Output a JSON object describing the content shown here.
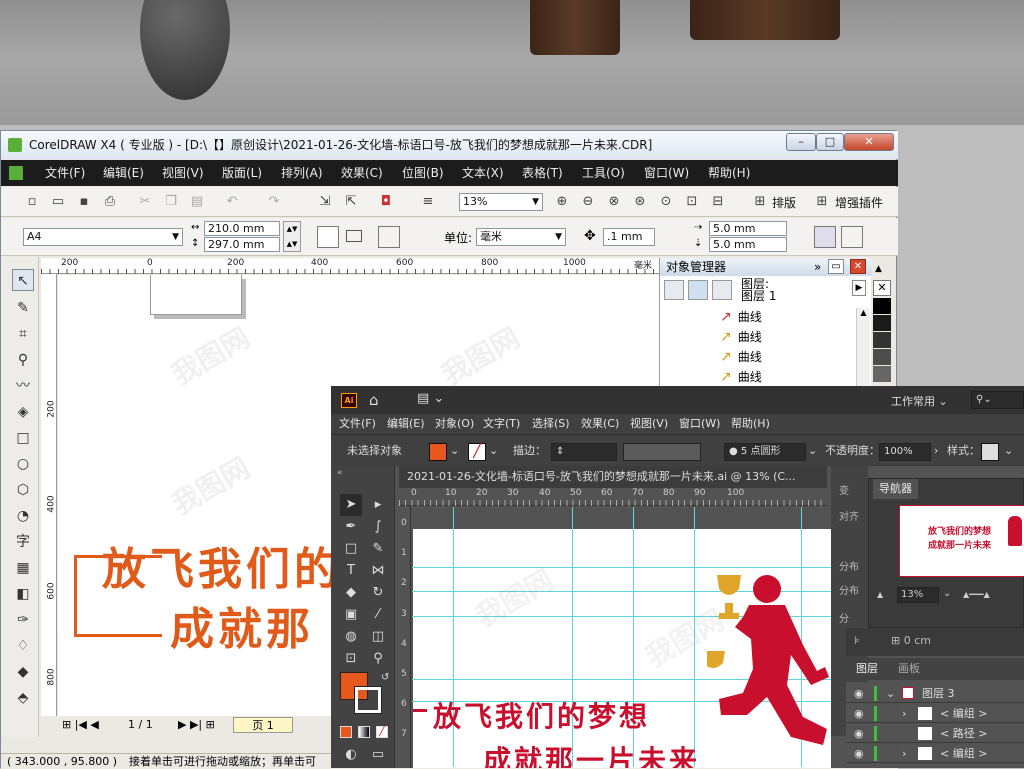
{
  "corel": {
    "title": "CorelDRAW X4 ( 专业版 ) - [D:\\【】原创设计\\2021-01-26-文化墙-标语口号-放飞我们的梦想成就那一片未来.CDR]",
    "menu": [
      "文件(F)",
      "编辑(E)",
      "视图(V)",
      "版面(L)",
      "排列(A)",
      "效果(C)",
      "位图(B)",
      "文本(X)",
      "表格(T)",
      "工具(O)",
      "窗口(W)",
      "帮助(H)"
    ],
    "zoom": "13%",
    "layout_label": "排版",
    "plugin_label": "增强插件",
    "paper": "A4",
    "width": "210.0 mm",
    "height": "297.0 mm",
    "units_label": "单位:",
    "units": "毫米",
    "nudge": ".1 mm",
    "dup_x": "5.0 mm",
    "dup_y": "5.0 mm",
    "ruler_h": [
      "200",
      "0",
      "200",
      "400",
      "600",
      "800",
      "1000",
      "毫米"
    ],
    "ruler_v": [
      "200",
      "400",
      "600",
      "800"
    ],
    "canvas_line1": "放飞我们的",
    "canvas_line2": "成就那",
    "page_nav": "1 / 1",
    "page_tab": "页 1",
    "status_coords": "( 343.000 , 95.800 )",
    "status_hint": "接着单击可进行拖动或缩放；再单击可",
    "obj_mgr": {
      "title": "对象管理器",
      "layer": "图层:",
      "layer_name": "图层 1",
      "items": [
        "曲线",
        "曲线",
        "曲线",
        "曲线"
      ]
    },
    "watermark": "我图网"
  },
  "ai": {
    "workspace": "工作常用",
    "menu": [
      "文件(F)",
      "编辑(E)",
      "对象(O)",
      "文字(T)",
      "选择(S)",
      "效果(C)",
      "视图(V)",
      "窗口(W)",
      "帮助(H)"
    ],
    "no_selection": "未选择对象",
    "stroke_label": "描边：",
    "brush": "5 点圆形",
    "opacity_label": "不透明度：",
    "opacity": "100%",
    "style_label": "样式：",
    "doc_tab": "2021-01-26-文化墙-标语口号-放飞我们的梦想成就那一片未来.ai @ 13% (C...",
    "ruler": [
      "0",
      "10",
      "20",
      "30",
      "40",
      "50",
      "60",
      "70",
      "80",
      "90",
      "100"
    ],
    "ruler_v": [
      "0",
      "1",
      "2",
      "3",
      "4",
      "5",
      "6",
      "7"
    ],
    "line1": "放飞我们的梦想",
    "line2": "成就那一片未来",
    "navigator": {
      "tab": "导航器",
      "zoom": "13%",
      "thumb_line1": "放飞我们的梦想",
      "thumb_line2": "成就那一片未来"
    },
    "side_labels": [
      "变",
      "对齐",
      "分布",
      "分布",
      "分"
    ],
    "layers_tabs": [
      "图层",
      "画板"
    ],
    "layers": [
      {
        "name": "图层 3"
      },
      {
        "name": "< 编组 >"
      },
      {
        "name": "< 路径 >"
      },
      {
        "name": "< 编组 >"
      }
    ],
    "colors": {
      "fill": "#e8581c",
      "figure": "#c8102e",
      "trophy": "#e0a52a"
    }
  }
}
